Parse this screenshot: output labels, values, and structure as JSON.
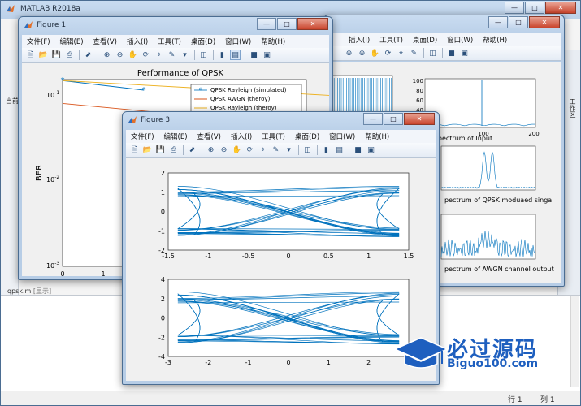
{
  "matlab": {
    "title": "MATLAB R2018a",
    "editor_tab": "qpsk.m",
    "editor_tab_suffix": "[显示]",
    "left_tab": "当前",
    "right_tab": "工作区",
    "status": {
      "row_label": "行",
      "row_value": "1",
      "col_label": "列",
      "col_value": "1"
    }
  },
  "menus": [
    "文件(F)",
    "编辑(E)",
    "查看(V)",
    "插入(I)",
    "工具(T)",
    "桌面(D)",
    "窗口(W)",
    "帮助(H)"
  ],
  "fig_bg": {
    "menus_visible": [
      "插入(I)",
      "工具(T)",
      "桌面(D)",
      "窗口(W)",
      "帮助(H)"
    ]
  },
  "figure1": {
    "title": "Figure 1",
    "chart_data": {
      "type": "line",
      "title": "Performance of QPSK",
      "ylabel": "BER",
      "xlabel": "",
      "yscale": "log",
      "ylim": [
        0.001,
        0.15
      ],
      "xlim": [
        0,
        2
      ],
      "xticks": [
        "0",
        "1"
      ],
      "yticks": [
        "10-1",
        "10-2",
        "10-3"
      ],
      "legend": [
        "QPSK Rayleigh (simulated)",
        "QPSK AWGN (theroy)",
        "QPSK Rayleigh (theroy)"
      ],
      "series": [
        {
          "name": "QPSK Rayleigh (simulated)",
          "x": [
            0,
            1
          ],
          "y": [
            0.146,
            0.113
          ]
        },
        {
          "name": "QPSK AWGN (theroy)",
          "x": [
            0,
            2
          ],
          "y": [
            0.079,
            0.035
          ]
        },
        {
          "name": "QPSK Rayleigh (theroy)",
          "x": [
            0,
            2
          ],
          "y": [
            0.146,
            0.09
          ]
        }
      ]
    }
  },
  "figure_bg": {
    "chart_data": [
      {
        "type": "line",
        "title": "Power spectrum of Input",
        "xticks": [
          "100",
          "200"
        ],
        "yticks": [
          "100",
          "80",
          "60",
          "40",
          "20"
        ],
        "peak_x": 100
      },
      {
        "type": "line",
        "title": "pectrum of QPSK moduaed singal",
        "xticks": [
          "100",
          "200"
        ]
      },
      {
        "type": "line",
        "title": "pectrum of AWGN channel output",
        "xticks": [
          "100",
          "200"
        ]
      }
    ]
  },
  "figure3": {
    "title": "Figure 3",
    "chart_data": [
      {
        "type": "line",
        "xlim": [
          -1.5,
          1.5
        ],
        "ylim": [
          -2,
          2
        ],
        "xticks": [
          "-1.5",
          "-1",
          "-0.5",
          "0",
          "0.5",
          "1",
          "1.5"
        ],
        "yticks": [
          "2",
          "1",
          "0",
          "-1",
          "-2"
        ],
        "upper_levels": [
          0.9,
          1.2
        ],
        "lower_levels": [
          -0.9,
          -1.2
        ]
      },
      {
        "type": "line",
        "xlim": [
          -3,
          3
        ],
        "ylim": [
          -4,
          4
        ],
        "xticks": [
          "-3",
          "-2",
          "-1",
          "0",
          "1",
          "2",
          "3"
        ],
        "yticks": [
          "4",
          "2",
          "0",
          "-2",
          "-4"
        ],
        "upper_levels": [
          1.8,
          2.5
        ],
        "lower_levels": [
          -1.8,
          -2.5
        ]
      }
    ]
  },
  "watermark": {
    "cn": "必过源码",
    "en": "Biguo100.com"
  },
  "colors": {
    "series_blue": "#0072bd",
    "awgn_red": "#d95319",
    "ray_orange": "#edb120"
  }
}
